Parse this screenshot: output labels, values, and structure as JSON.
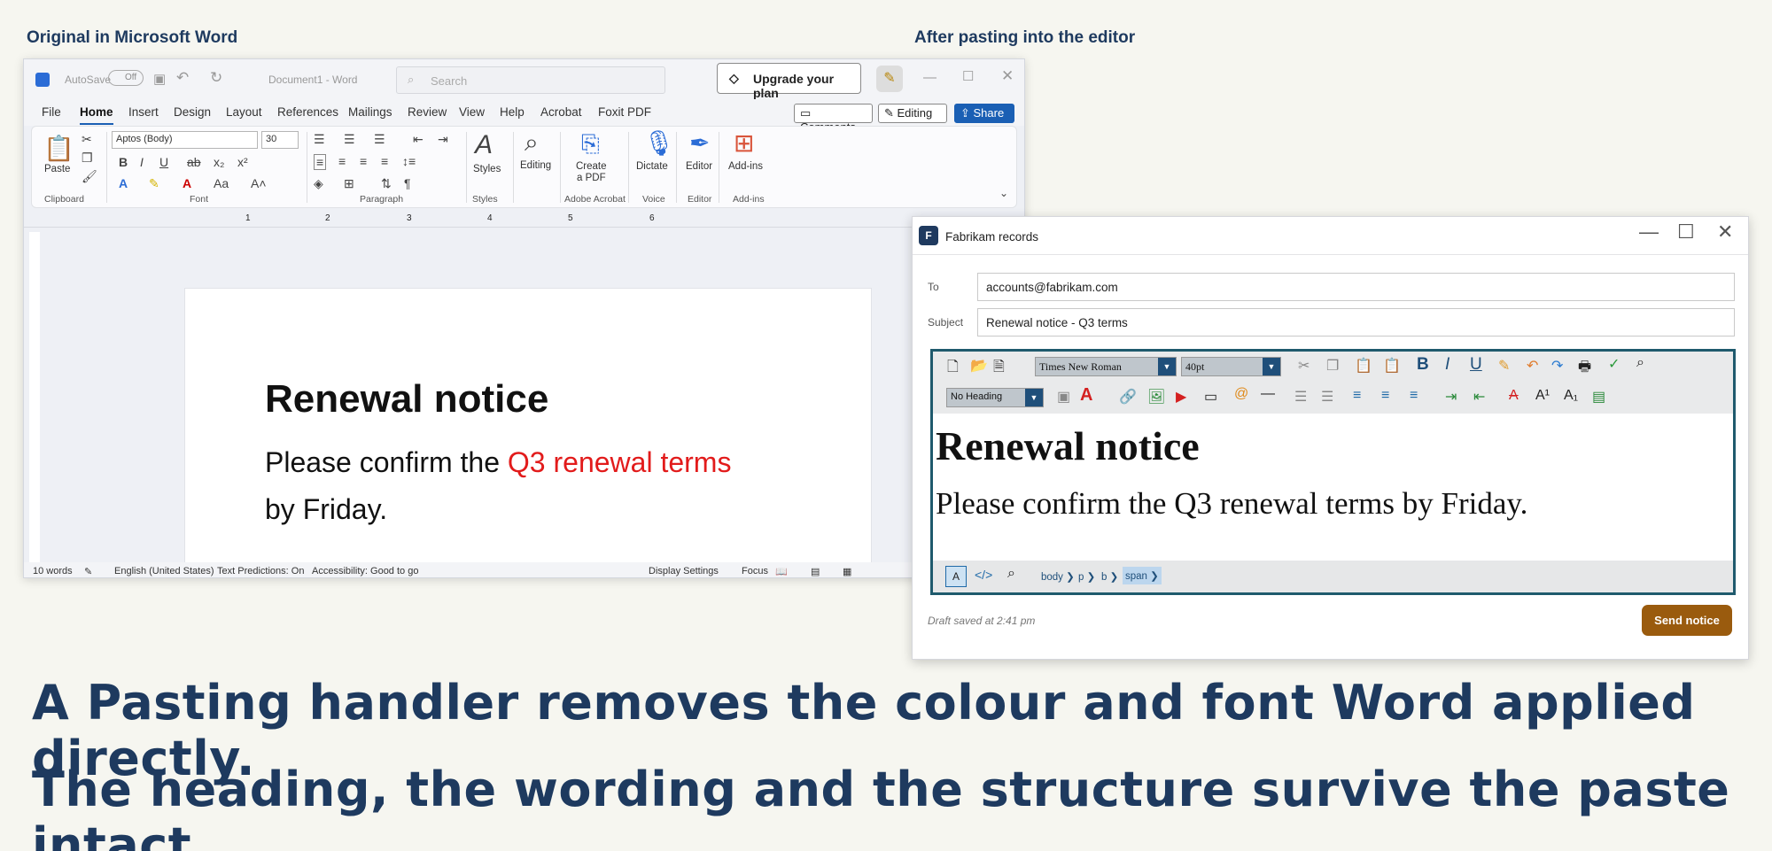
{
  "captions": {
    "left": "Original in Microsoft Word",
    "right": "After pasting into the editor"
  },
  "word": {
    "autosave": "AutoSave",
    "toggle": "Off",
    "doc_title": "Document1 - Word",
    "search_placeholder": "Search",
    "upgrade": "Upgrade your plan",
    "menu": [
      "File",
      "Home",
      "Insert",
      "Design",
      "Layout",
      "References",
      "Mailings",
      "Review",
      "View",
      "Help",
      "Acrobat",
      "Foxit PDF"
    ],
    "comments": "Comments",
    "editing": "Editing",
    "share": "Share",
    "font": "Aptos (Body)",
    "size": "30",
    "labels": {
      "paste": "Paste",
      "styles": "Styles",
      "editing": "Editing",
      "create_pdf_1": "Create",
      "create_pdf_2": "a PDF",
      "dictate": "Dictate",
      "editor": "Editor",
      "addins": "Add-ins"
    },
    "groups": [
      "Clipboard",
      "Font",
      "Paragraph",
      "Styles",
      "Adobe Acrobat",
      "Voice",
      "Editor",
      "Add-ins"
    ],
    "ruler": [
      "1",
      "2",
      "3",
      "4",
      "5",
      "6"
    ],
    "heading": "Renewal notice",
    "body_pre": "Please confirm the ",
    "body_red": "Q3 renewal terms",
    "body_post": "by Friday.",
    "status": {
      "words": "10 words",
      "lang": "English (United States)",
      "pred": "Text Predictions: On",
      "acc": "Accessibility: Good to go",
      "display": "Display Settings",
      "focus": "Focus"
    },
    "red_color": "#e21b1b"
  },
  "editor": {
    "app_letter": "F",
    "title": "Fabrikam records",
    "to_label": "To",
    "to_value": "accounts@fabrikam.com",
    "subject_label": "Subject",
    "subject_value": "Renewal notice - Q3 terms",
    "font": "Times New Roman",
    "size": "40pt",
    "block": "No Heading",
    "heading": "Renewal notice",
    "body": "Please confirm the Q3 renewal terms by Friday.",
    "crumbs": [
      "body",
      "p",
      "b",
      "span"
    ],
    "draft": "Draft saved at 2:41 pm",
    "send": "Send notice",
    "accent": "#9a5b0e"
  },
  "statement": {
    "line1": "A Pasting handler removes the colour and font Word applied directly.",
    "line2": "The heading, the wording and the structure survive the paste intact."
  }
}
